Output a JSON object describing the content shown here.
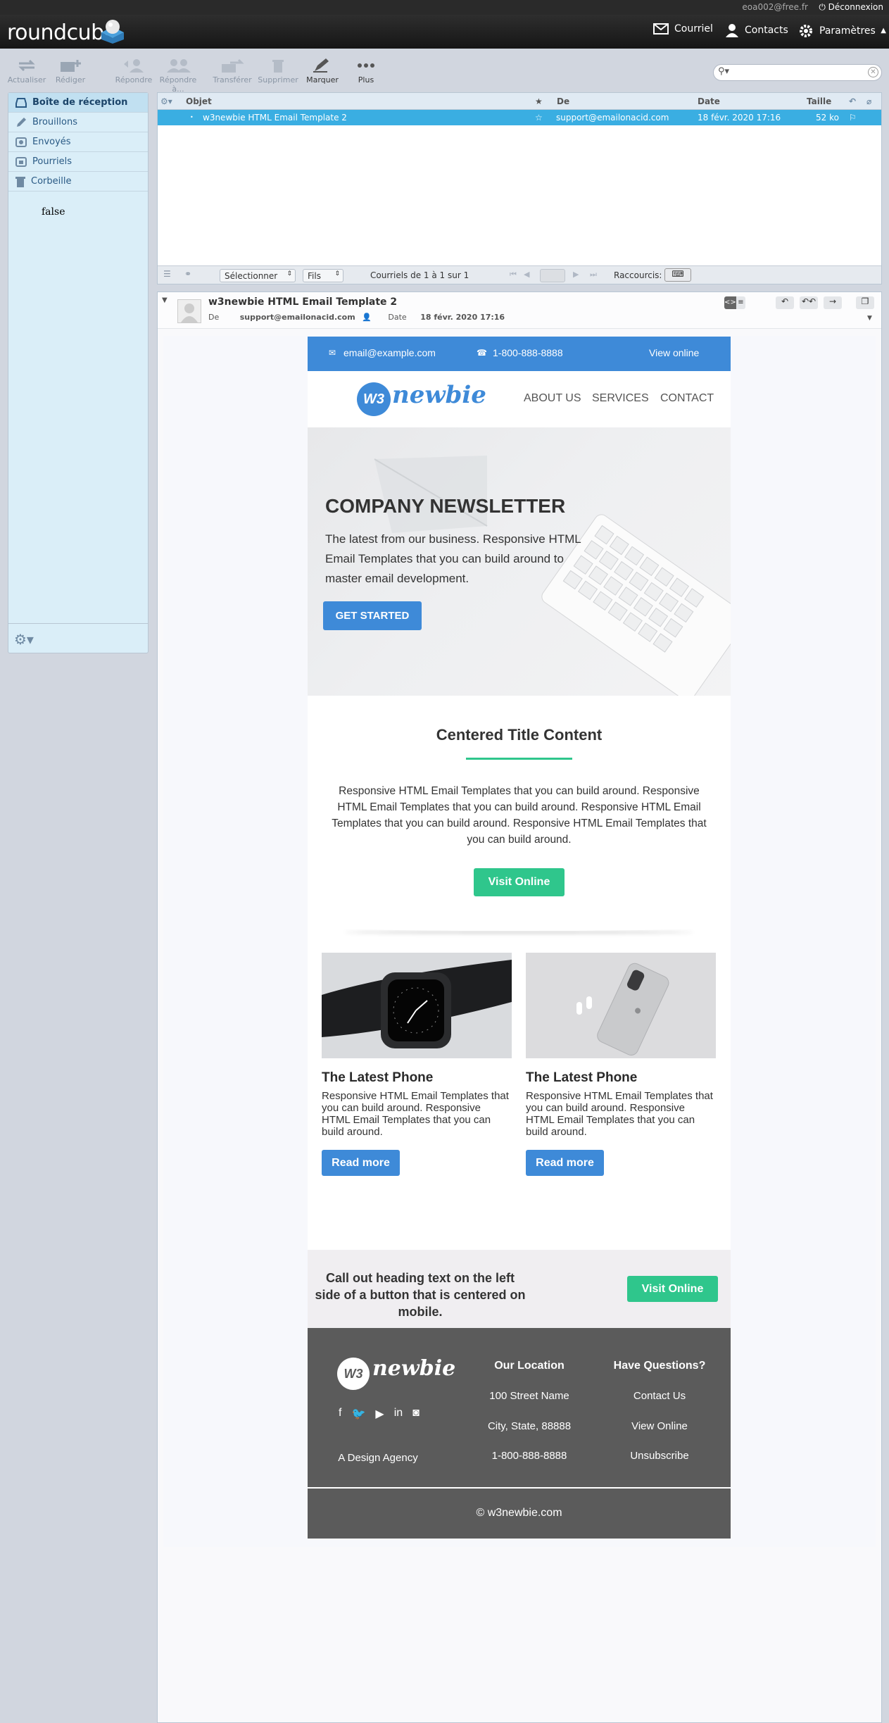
{
  "app": {
    "user_email": "eoa002@free.fr",
    "logout": "Déconnexion",
    "logo": "roundcube",
    "nav": {
      "mail": "Courriel",
      "contacts": "Contacts",
      "settings": "Paramètres"
    }
  },
  "toolbar": {
    "refresh": "Actualiser",
    "compose": "Rédiger",
    "reply": "Répondre",
    "reply_all": "Répondre à...",
    "forward": "Transférer",
    "delete": "Supprimer",
    "mark": "Marquer",
    "more": "Plus"
  },
  "folders": [
    {
      "label": "Boîte de réception",
      "icon": "inbox-icon"
    },
    {
      "label": "Brouillons",
      "icon": "pencil-icon"
    },
    {
      "label": "Envoyés",
      "icon": "sent-icon"
    },
    {
      "label": "Pourriels",
      "icon": "junk-icon"
    },
    {
      "label": "Corbeille",
      "icon": "trash-icon"
    }
  ],
  "folder_stray_text": "false",
  "message_list": {
    "columns": {
      "subject": "Objet",
      "from": "De",
      "date": "Date",
      "size": "Taille"
    },
    "rows": [
      {
        "subject": "w3newbie HTML Email Template 2",
        "from": "support@emailonacid.com",
        "date": "18 févr. 2020 17:16",
        "size": "52 ko"
      }
    ],
    "footer": {
      "select": "Sélectionner",
      "threads": "Fils",
      "count": "Courriels de 1 à 1 sur 1",
      "shortcuts": "Raccourcis:"
    }
  },
  "preview": {
    "subject": "w3newbie HTML Email Template 2",
    "from_label": "De",
    "from": "support@emailonacid.com",
    "date_label": "Date",
    "date": "18 févr. 2020 17:16"
  },
  "email": {
    "top": {
      "email": "email@example.com",
      "phone": "1-800-888-8888",
      "view_online": "View online"
    },
    "logo_mark": "W3",
    "logo_text": "newbie",
    "nav": [
      "ABOUT US",
      "SERVICES",
      "CONTACT"
    ],
    "hero": {
      "title": "COMPANY NEWSLETTER",
      "text": "The latest from our business. Responsive HTML Email Templates that you can build around to master email development.",
      "button": "GET STARTED"
    },
    "centered": {
      "title": "Centered Title Content",
      "text": "Responsive HTML Email Templates that you can build around. Responsive HTML Email Templates that you can build around. Responsive HTML Email Templates that you can build around. Responsive HTML Email Templates that you can build around.",
      "button": "Visit Online"
    },
    "cards": [
      {
        "title": "The Latest Phone",
        "text": "Responsive HTML Email Templates that you can build around. Responsive HTML Email Templates that you can build around.",
        "button": "Read more"
      },
      {
        "title": "The Latest Phone",
        "text": "Responsive HTML Email Templates that you can build around. Responsive HTML Email Templates that you can build around.",
        "button": "Read more"
      }
    ],
    "callout": {
      "text": "Call out heading text on the left side of a button that is centered on mobile.",
      "button": "Visit Online"
    },
    "footer": {
      "agency": "A Design Agency",
      "location_title": "Our Location",
      "address1": "100 Street Name",
      "address2": "City, State, 88888",
      "phone": "1-800-888-8888",
      "questions_title": "Have Questions?",
      "contact": "Contact Us",
      "view_online": "View Online",
      "unsubscribe": "Unsubscribe",
      "copyright": "© w3newbie.com"
    }
  },
  "colors": {
    "accent_blue": "#3e8ad8",
    "accent_green": "#2fc68c",
    "selected_row": "#3aaee2",
    "footer_gray": "#5b5b5b"
  }
}
